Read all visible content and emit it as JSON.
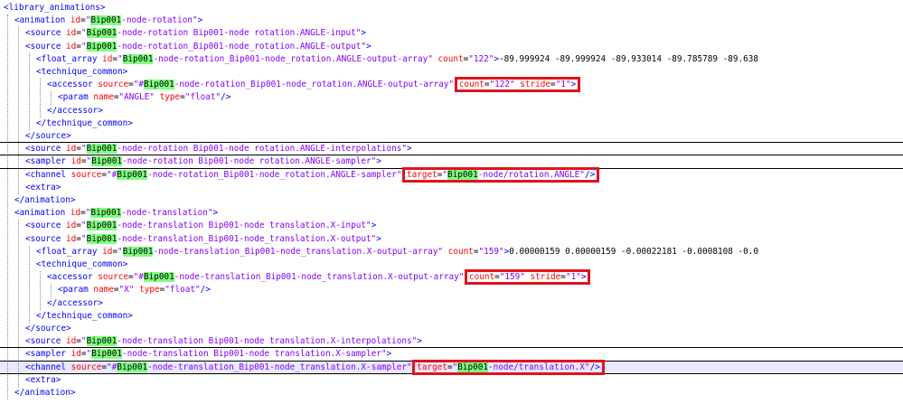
{
  "editor": {
    "lines": [
      {
        "indent": 0,
        "parts": [
          [
            "tag",
            "<library_animations>"
          ]
        ]
      },
      {
        "indent": 1,
        "parts": [
          [
            "tag",
            "<animation "
          ],
          [
            "attr",
            "id"
          ],
          [
            "eq",
            "="
          ],
          [
            "val",
            "\"@Bip001@-node-rotation\""
          ],
          [
            "tag",
            ">"
          ]
        ]
      },
      {
        "indent": 2,
        "parts": [
          [
            "tag",
            "<source "
          ],
          [
            "attr",
            "id"
          ],
          [
            "eq",
            "="
          ],
          [
            "val",
            "\"@Bip001@-node-rotation Bip001-node rotation.ANGLE-input\""
          ],
          [
            "tag",
            ">"
          ]
        ]
      },
      {
        "indent": 2,
        "parts": [
          [
            "tag",
            "<source "
          ],
          [
            "attr",
            "id"
          ],
          [
            "eq",
            "="
          ],
          [
            "val",
            "\"@Bip001@-node-rotation_Bip001-node_rotation.ANGLE-output\""
          ],
          [
            "tag",
            ">"
          ]
        ]
      },
      {
        "indent": 3,
        "parts": [
          [
            "tag",
            "<float_array "
          ],
          [
            "attr",
            "id"
          ],
          [
            "eq",
            "="
          ],
          [
            "val",
            "\"@Bip001@-node-rotation_Bip001-node_rotation.ANGLE-output-array\" "
          ],
          [
            "attr",
            "count"
          ],
          [
            "eq",
            "="
          ],
          [
            "val",
            "\"122\""
          ],
          [
            "tag",
            ">"
          ],
          [
            "txt",
            "-89.999924 -89.999924 -89.933014 -89.785789 -89.638"
          ]
        ]
      },
      {
        "indent": 3,
        "parts": [
          [
            "tag",
            "<technique_common>"
          ]
        ]
      },
      {
        "indent": 4,
        "parts": [
          [
            "tag",
            "<accessor "
          ],
          [
            "attr",
            "source"
          ],
          [
            "eq",
            "="
          ],
          [
            "val",
            "\"#@Bip001@-node-rotation_Bip001-node_rotation.ANGLE-output-array\" "
          ],
          [
            "attr",
            "count"
          ],
          [
            "eq",
            "="
          ],
          [
            "val",
            "\"122\" "
          ],
          [
            "attr",
            "stride"
          ],
          [
            "eq",
            "="
          ],
          [
            "val",
            "\"1\""
          ],
          [
            "tag",
            ">"
          ]
        ]
      },
      {
        "indent": 5,
        "parts": [
          [
            "tag",
            "<param "
          ],
          [
            "attr",
            "name"
          ],
          [
            "eq",
            "="
          ],
          [
            "val",
            "\"ANGLE\" "
          ],
          [
            "attr",
            "type"
          ],
          [
            "eq",
            "="
          ],
          [
            "val",
            "\"float\""
          ],
          [
            "tag",
            "/>"
          ]
        ]
      },
      {
        "indent": 4,
        "parts": [
          [
            "tag",
            "</accessor>"
          ]
        ]
      },
      {
        "indent": 3,
        "parts": [
          [
            "tag",
            "</technique_common>"
          ]
        ]
      },
      {
        "indent": 2,
        "parts": [
          [
            "tag",
            "</source>"
          ]
        ]
      },
      {
        "indent": 2,
        "parts": [
          [
            "tag",
            "<source "
          ],
          [
            "attr",
            "id"
          ],
          [
            "eq",
            "="
          ],
          [
            "val",
            "\"@Bip001@-node-rotation Bip001-node rotation.ANGLE-interpolations\""
          ],
          [
            "tag",
            ">"
          ]
        ]
      },
      {
        "indent": 2,
        "parts": [
          [
            "tag",
            "<sampler "
          ],
          [
            "attr",
            "id"
          ],
          [
            "eq",
            "="
          ],
          [
            "val",
            "\"@Bip001@-node-rotation Bip001-node rotation.ANGLE-sampler\""
          ],
          [
            "tag",
            ">"
          ]
        ]
      },
      {
        "indent": 2,
        "parts": [
          [
            "tag",
            "<channel "
          ],
          [
            "attr",
            "source"
          ],
          [
            "eq",
            "="
          ],
          [
            "val",
            "\"#@Bip001@-node-rotation_Bip001-node_rotation.ANGLE-sampler\" "
          ],
          [
            "attr",
            "target"
          ],
          [
            "eq",
            "="
          ],
          [
            "val",
            "\"@Bip001@-node/rotation.ANGLE\""
          ],
          [
            "tag",
            "/>"
          ]
        ]
      },
      {
        "indent": 2,
        "parts": [
          [
            "tag",
            "<extra>"
          ]
        ]
      },
      {
        "indent": 1,
        "parts": [
          [
            "tag",
            "</animation>"
          ]
        ]
      },
      {
        "indent": 1,
        "parts": [
          [
            "tag",
            "<animation "
          ],
          [
            "attr",
            "id"
          ],
          [
            "eq",
            "="
          ],
          [
            "val",
            "\"@Bip001@-node-translation\""
          ],
          [
            "tag",
            ">"
          ]
        ]
      },
      {
        "indent": 2,
        "parts": [
          [
            "tag",
            "<source "
          ],
          [
            "attr",
            "id"
          ],
          [
            "eq",
            "="
          ],
          [
            "val",
            "\"@Bip001@-node-translation Bip001-node translation.X-input\""
          ],
          [
            "tag",
            ">"
          ]
        ]
      },
      {
        "indent": 2,
        "parts": [
          [
            "tag",
            "<source "
          ],
          [
            "attr",
            "id"
          ],
          [
            "eq",
            "="
          ],
          [
            "val",
            "\"@Bip001@-node-translation_Bip001-node_translation.X-output\""
          ],
          [
            "tag",
            ">"
          ]
        ]
      },
      {
        "indent": 3,
        "parts": [
          [
            "tag",
            "<float_array "
          ],
          [
            "attr",
            "id"
          ],
          [
            "eq",
            "="
          ],
          [
            "val",
            "\"@Bip001@-node-translation_Bip001-node_translation.X-output-array\" "
          ],
          [
            "attr",
            "count"
          ],
          [
            "eq",
            "="
          ],
          [
            "val",
            "\"159\""
          ],
          [
            "tag",
            ">"
          ],
          [
            "txt",
            "0.00000159 0.00000159 -0.00022181 -0.0008108 -0.0"
          ]
        ]
      },
      {
        "indent": 3,
        "parts": [
          [
            "tag",
            "<technique_common>"
          ]
        ]
      },
      {
        "indent": 4,
        "parts": [
          [
            "tag",
            "<accessor "
          ],
          [
            "attr",
            "source"
          ],
          [
            "eq",
            "="
          ],
          [
            "val",
            "\"#@Bip001@-node-translation_Bip001-node_translation.X-output-array\" "
          ],
          [
            "attr",
            "count"
          ],
          [
            "eq",
            "="
          ],
          [
            "val",
            "\"159\" "
          ],
          [
            "attr",
            "stride"
          ],
          [
            "eq",
            "="
          ],
          [
            "val",
            "\"1\""
          ],
          [
            "tag",
            ">"
          ]
        ]
      },
      {
        "indent": 5,
        "parts": [
          [
            "tag",
            "<param "
          ],
          [
            "attr",
            "name"
          ],
          [
            "eq",
            "="
          ],
          [
            "val",
            "\"X\" "
          ],
          [
            "attr",
            "type"
          ],
          [
            "eq",
            "="
          ],
          [
            "val",
            "\"float\""
          ],
          [
            "tag",
            "/>"
          ]
        ]
      },
      {
        "indent": 4,
        "parts": [
          [
            "tag",
            "</accessor>"
          ]
        ]
      },
      {
        "indent": 3,
        "parts": [
          [
            "tag",
            "</technique_common>"
          ]
        ]
      },
      {
        "indent": 2,
        "parts": [
          [
            "tag",
            "</source>"
          ]
        ]
      },
      {
        "indent": 2,
        "parts": [
          [
            "tag",
            "<source "
          ],
          [
            "attr",
            "id"
          ],
          [
            "eq",
            "="
          ],
          [
            "val",
            "\"@Bip001@-node-translation Bip001-node translation.X-interpolations\""
          ],
          [
            "tag",
            ">"
          ]
        ]
      },
      {
        "indent": 2,
        "parts": [
          [
            "tag",
            "<sampler "
          ],
          [
            "attr",
            "id"
          ],
          [
            "eq",
            "="
          ],
          [
            "val",
            "\"@Bip001@-node-translation Bip001-node translation.X-sampler\""
          ],
          [
            "tag",
            ">"
          ]
        ]
      },
      {
        "indent": 2,
        "highlight": true,
        "parts": [
          [
            "tag",
            "<channel "
          ],
          [
            "attr",
            "source"
          ],
          [
            "eq",
            "="
          ],
          [
            "val",
            "\"#@Bip001@-node-translation_Bip001-node_translation.X-sampler\" "
          ],
          [
            "attr",
            "target"
          ],
          [
            "eq",
            "="
          ],
          [
            "val",
            "\"@Bip001@-node/translation.X\""
          ],
          [
            "tag",
            "/>"
          ]
        ]
      },
      {
        "indent": 2,
        "parts": [
          [
            "tag",
            "<extra>"
          ]
        ]
      },
      {
        "indent": 1,
        "parts": [
          [
            "tag",
            "</animation>"
          ]
        ]
      }
    ],
    "callouts": [
      {
        "line": 6,
        "from": 4,
        "to": 10
      },
      {
        "line": 13,
        "from": 4,
        "to": 7
      },
      {
        "line": 21,
        "from": 4,
        "to": 10
      },
      {
        "line": 28,
        "from": 4,
        "to": 7
      }
    ],
    "separators": [
      11,
      12,
      13,
      27,
      28,
      29
    ],
    "colors": {
      "tag": "#0000ff",
      "attribute": "#ff0000",
      "value": "#8000ff",
      "match_highlight": "#80ff80",
      "callout": "#e0141c",
      "selected_line": "#e8e8ff"
    }
  }
}
